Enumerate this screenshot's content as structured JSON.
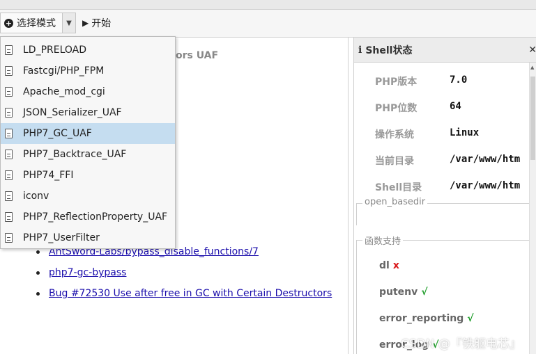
{
  "toolbar": {
    "mode_button_label": "选择模式",
    "start_button_label": "开始"
  },
  "dropdown": {
    "items": [
      {
        "label": "LD_PRELOAD",
        "selected": false
      },
      {
        "label": "Fastcgi/PHP_FPM",
        "selected": false
      },
      {
        "label": "Apache_mod_cgi",
        "selected": false
      },
      {
        "label": "JSON_Serializer_UAF",
        "selected": false
      },
      {
        "label": "PHP7_GC_UAF",
        "selected": true
      },
      {
        "label": "PHP7_Backtrace_UAF",
        "selected": false
      },
      {
        "label": "PHP74_FFI",
        "selected": false
      },
      {
        "label": "iconv",
        "selected": false
      },
      {
        "label": "PHP7_ReflectionProperty_UAF",
        "selected": false
      },
      {
        "label": "PHP7_UserFilter",
        "selected": false
      }
    ]
  },
  "main": {
    "heading_fragment": "ors UAF",
    "links": [
      "AntSword-Labs/bypass_disable_functions/7",
      "php7-gc-bypass",
      "Bug #72530 Use after free in GC with Certain Destructors"
    ]
  },
  "panel": {
    "title": "Shell状态",
    "info": [
      {
        "key": "PHP版本",
        "value": "7.0"
      },
      {
        "key": "PHP位数",
        "value": "64"
      },
      {
        "key": "操作系统",
        "value": "Linux"
      },
      {
        "key": "当前目录",
        "value": "/var/www/htm"
      },
      {
        "key": "Shell目录",
        "value": "/var/www/htm"
      }
    ],
    "open_basedir_label": "open_basedir",
    "functions_label": "函数支持",
    "functions": [
      {
        "name": "dl",
        "supported": false
      },
      {
        "name": "putenv",
        "supported": true
      },
      {
        "name": "error_reporting",
        "supported": true
      },
      {
        "name": "error_log",
        "supported": true
      }
    ],
    "status_marks": {
      "yes": "√",
      "no": "x"
    }
  },
  "watermark": "CSDN @『铁躯电芯』",
  "colors": {
    "selected_bg": "#c5ddf0",
    "link": "#1a0dab",
    "cross": "#d9191c",
    "check": "#1f9d2a"
  }
}
